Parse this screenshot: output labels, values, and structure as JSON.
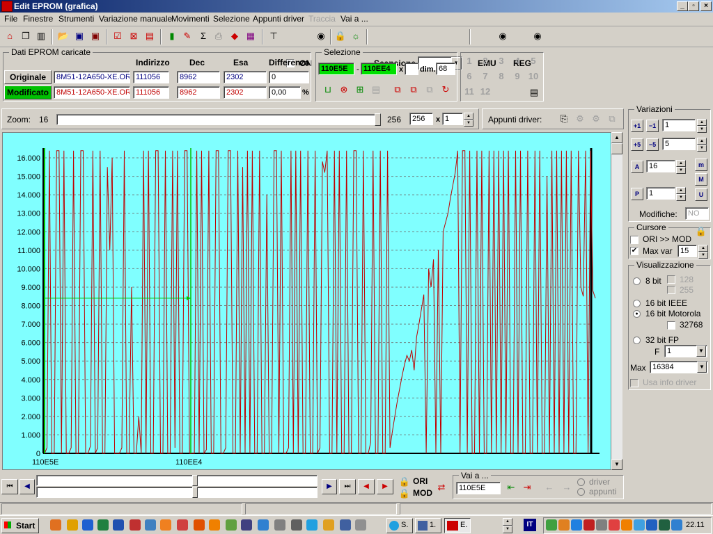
{
  "window": {
    "title": "Edit EPROM (grafica)"
  },
  "menu": [
    "File",
    "Finestre",
    "Strumenti",
    "Variazione manuale",
    "Movimenti",
    "Selezione",
    "Appunti driver",
    "Traccia",
    "Vai a ..."
  ],
  "toolbar": {
    "on_label": "ON",
    "scan_label": "Scansione",
    "emu_label": "EMU",
    "reg_label": "REG"
  },
  "eprom": {
    "group_label": "Dati EPROM caricate",
    "headers": {
      "addr": "Indirizzo",
      "dec": "Dec",
      "hex": "Esa",
      "diff": "Differenza"
    },
    "orig": {
      "button": "Originale",
      "file": "8M51-12A650-XE.ORI",
      "addr": "111056",
      "dec": "8962",
      "hex": "2302",
      "diff": "0"
    },
    "mod": {
      "button": "Modificato",
      "file": "8M51-12A650-XE.ORI",
      "addr": "111056",
      "dec": "8962",
      "hex": "2302",
      "diff": "0,00",
      "unit": "%"
    }
  },
  "selection": {
    "group_label": "Selezione",
    "start": "110E5E",
    "dash": "-",
    "end": "110EE4",
    "x": "x",
    "x_value": "",
    "dim_label": "dim.",
    "dim": "68"
  },
  "numpad": [
    "1",
    "2",
    "3",
    "4",
    "5",
    "6",
    "7",
    "8",
    "9",
    "10",
    "11",
    "12"
  ],
  "zoom": {
    "label": "Zoom:",
    "value": "16",
    "max": "256",
    "input": "256",
    "x": "x",
    "mult": "1"
  },
  "clipboard": {
    "label": "Appunti driver:"
  },
  "variations": {
    "group_label": "Variazioni",
    "v1": "1",
    "v2": "5",
    "v3": "16",
    "v4": "1",
    "modifiche_label": "Modifiche:",
    "modifiche": "NO"
  },
  "cursor": {
    "group_label": "Cursore",
    "ori_mod": "ORI >> MOD",
    "maxvar_label": "Max var",
    "maxvar": "15"
  },
  "display": {
    "group_label": "Visualizzazione",
    "b8": "8 bit",
    "c128": "128",
    "c255": "255",
    "ieee": "16 bit IEEE",
    "moto": "16 bit Motorola",
    "c32768": "32768",
    "fp": "32 bit FP",
    "f_label": "F",
    "f_value": "1",
    "max_label": "Max",
    "max_value": "16384",
    "use_info": "Usa info driver"
  },
  "bottom": {
    "ori": "ORI",
    "mod": "MOD",
    "goto_label": "Vai a ...",
    "goto_value": "110E5E",
    "driver": "driver",
    "appunti": "appunti"
  },
  "taskbar": {
    "start": "Start",
    "task1": "S.",
    "task2": "1.",
    "task3": "E.",
    "lang": "IT",
    "clock": "22.11"
  },
  "chart_data": {
    "type": "line",
    "yticks": [
      "0",
      "1.000",
      "2.000",
      "3.000",
      "4.000",
      "5.000",
      "6.000",
      "7.000",
      "8.000",
      "9.000",
      "10.000",
      "11.000",
      "12.000",
      "13.000",
      "14.000",
      "15.000",
      "16.000"
    ],
    "ylim": [
      0,
      16384
    ],
    "xlabels": [
      "110E5E",
      "110EE4"
    ],
    "cursor_value": 8400,
    "series": [
      {
        "values": [
          0,
          300,
          16384,
          0,
          0,
          16384,
          16384,
          0,
          16384,
          0,
          0,
          300,
          16384,
          0,
          0,
          16384,
          16384,
          0,
          0,
          400,
          16384,
          0,
          300,
          16384,
          0,
          0,
          15500,
          11000,
          16000,
          0,
          0,
          0,
          300,
          16384,
          0,
          0,
          9000,
          0,
          0,
          2000,
          0,
          16384,
          0,
          16384,
          0,
          0,
          16384,
          16384,
          0,
          0,
          16384,
          0,
          0,
          16384,
          300,
          16384,
          0,
          0,
          16384,
          16384,
          0,
          0,
          0,
          16384,
          0,
          16384,
          0,
          200,
          16384,
          0,
          0,
          16384,
          16384,
          0,
          0,
          300,
          16384,
          16384,
          0,
          0,
          16384,
          0,
          15500,
          0,
          16384,
          0,
          16384,
          0,
          0,
          16384,
          0,
          0,
          14000,
          0,
          0,
          16384,
          16384,
          0,
          16384,
          0,
          0,
          300,
          16384,
          0,
          16384,
          0,
          16384,
          0,
          0,
          16384,
          0,
          0,
          16384,
          0,
          300,
          15800,
          15200,
          16384,
          0,
          0,
          16384,
          0,
          16384,
          0,
          0,
          16384,
          0,
          0,
          16384,
          16384,
          0,
          0,
          16384,
          0,
          0,
          600,
          16384,
          0,
          0,
          16384,
          0,
          0,
          16384,
          300,
          1200,
          2000,
          2800,
          3500,
          4200,
          4800,
          5300,
          5000,
          5600,
          4500,
          6300,
          7000,
          7800,
          8600,
          0,
          10000,
          9000,
          10500,
          0,
          11000,
          0,
          12000,
          12500,
          13000,
          13800,
          14500,
          15200,
          16384,
          0,
          16384,
          16384,
          0,
          16384,
          0,
          0,
          16384,
          0,
          16384,
          0,
          0,
          16384,
          0,
          16384,
          0,
          16384,
          0,
          16384,
          0,
          16384,
          0,
          0,
          16384,
          0,
          16384,
          0,
          0,
          16384,
          0,
          0,
          16384,
          0,
          16384,
          0,
          0,
          15000,
          0,
          16384,
          0,
          16384,
          0,
          16384,
          0,
          16384,
          0,
          16384,
          0,
          0,
          16384,
          9000,
          8500,
          16384,
          0,
          16384,
          8800,
          8400
        ]
      }
    ]
  }
}
